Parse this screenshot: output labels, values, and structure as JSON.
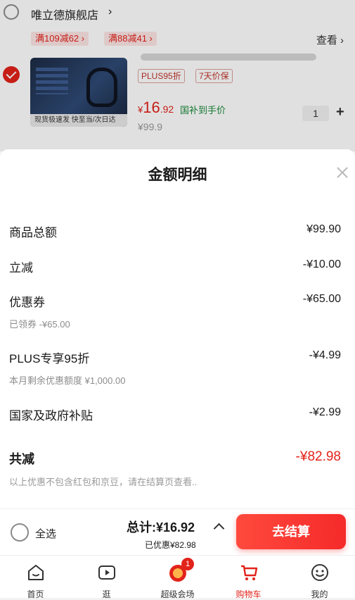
{
  "cart": {
    "shop_name": "唯立德旗舰店",
    "shop_arrow": "›",
    "promos": [
      "满109减62 ›",
      "满88减41 ›"
    ],
    "view_label": "查看 ›",
    "item": {
      "thumb_strip": "现货极速发  快至当/次日达",
      "tags": [
        "PLUS95折",
        "7天价保"
      ],
      "price_symbol": "¥",
      "price_int": "16",
      "price_dec": ".92",
      "subsidy_text": "国补到手价",
      "original_price": "¥99.9",
      "quantity": "1",
      "plus_label": "+"
    }
  },
  "sheet": {
    "title": "金额明细",
    "rows": [
      {
        "label": "商品总额",
        "value": "¥99.90"
      },
      {
        "label": "立减",
        "value": "-¥10.00"
      },
      {
        "label": "优惠券",
        "value": "-¥65.00",
        "sub": "已领券 -¥65.00"
      },
      {
        "label": "PLUS专享95折",
        "value": "-¥4.99",
        "sub": "本月剩余优惠额度 ¥1,000.00"
      },
      {
        "label": "国家及政府补贴",
        "value": "-¥2.99"
      }
    ],
    "total_label": "共减",
    "total_value": "-¥82.98",
    "note": "以上优惠不包含红包和京豆，请在结算页查看.."
  },
  "checkout": {
    "select_all": "全选",
    "total_text": "总计:¥16.92",
    "saved_text": "已优惠¥82.98",
    "button": "去结算"
  },
  "tabs": [
    {
      "label": "首页",
      "icon": "home-icon"
    },
    {
      "label": "逛",
      "icon": "video-icon"
    },
    {
      "label": "超级会场",
      "icon": "super-venue-icon",
      "badge": "1"
    },
    {
      "label": "购物车",
      "icon": "cart-icon",
      "active": true
    },
    {
      "label": "我的",
      "icon": "profile-icon"
    }
  ],
  "colors": {
    "accent": "#e2231a",
    "subsidy_green": "#1a8a3a",
    "muted_text": "#8c8c8c"
  }
}
